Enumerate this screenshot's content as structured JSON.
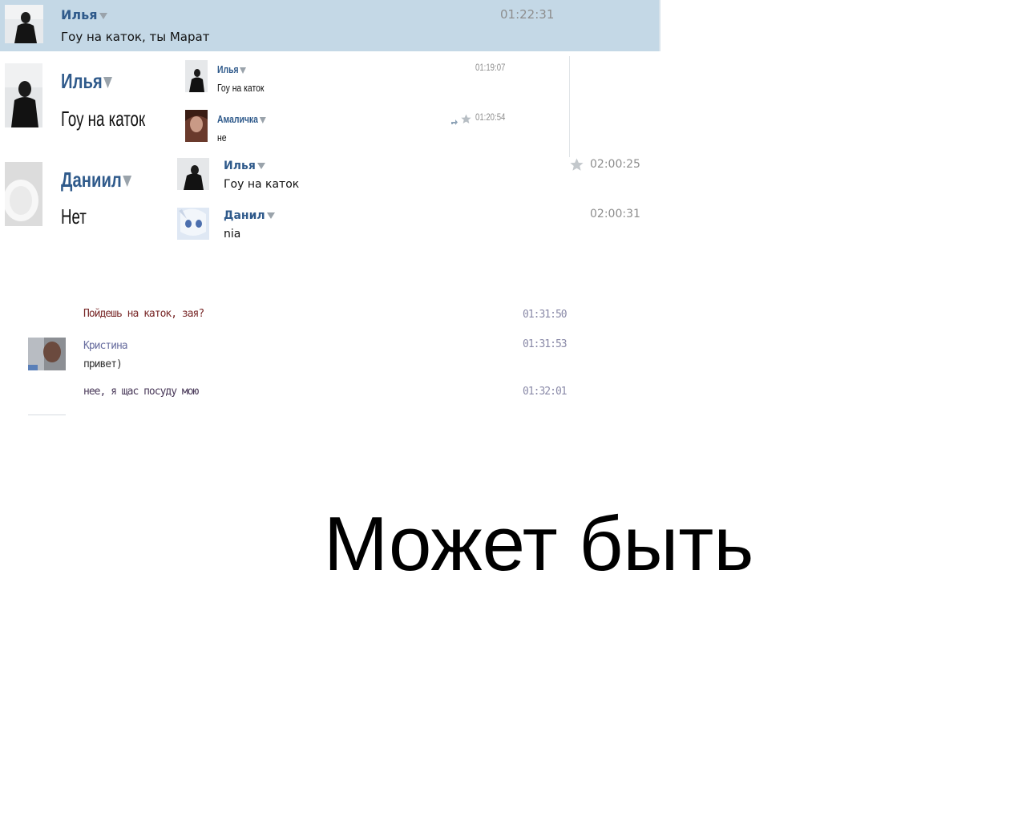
{
  "top_message": {
    "name": "Илья",
    "text": "Гоу на каток, ты Марат",
    "time": "01:22:31"
  },
  "zoom_left": [
    {
      "name": "Илья",
      "text": "Гоу на каток"
    },
    {
      "name": "Даниил",
      "text": "Нет"
    }
  ],
  "small_chat": [
    {
      "name": "Илья",
      "text": "Гоу на каток",
      "time": "01:19:07"
    },
    {
      "name": "Амаличка",
      "text": "не",
      "time": "01:20:54"
    }
  ],
  "mid_chat": [
    {
      "name": "Илья",
      "text": "Гоу на каток",
      "time": "02:00:25"
    },
    {
      "name": "Данил",
      "text": "nia",
      "time": "02:00:31"
    }
  ],
  "pixel_chat": {
    "line1": {
      "text": "Пойдешь на каток, зая?",
      "time": "01:31:50"
    },
    "user": {
      "name": "Кристина",
      "time": "01:31:53"
    },
    "line2": {
      "text": "привет)"
    },
    "line3": {
      "text": "нее, я щас посуду мою",
      "time": "01:32:01"
    }
  },
  "caption": "Может быть",
  "colors": {
    "highlight": "#c4d8e6",
    "name": "#2f5a8b",
    "time": "#8d8d8d"
  },
  "icons": [
    "triangle-down-icon",
    "star-icon",
    "reply-icon"
  ]
}
